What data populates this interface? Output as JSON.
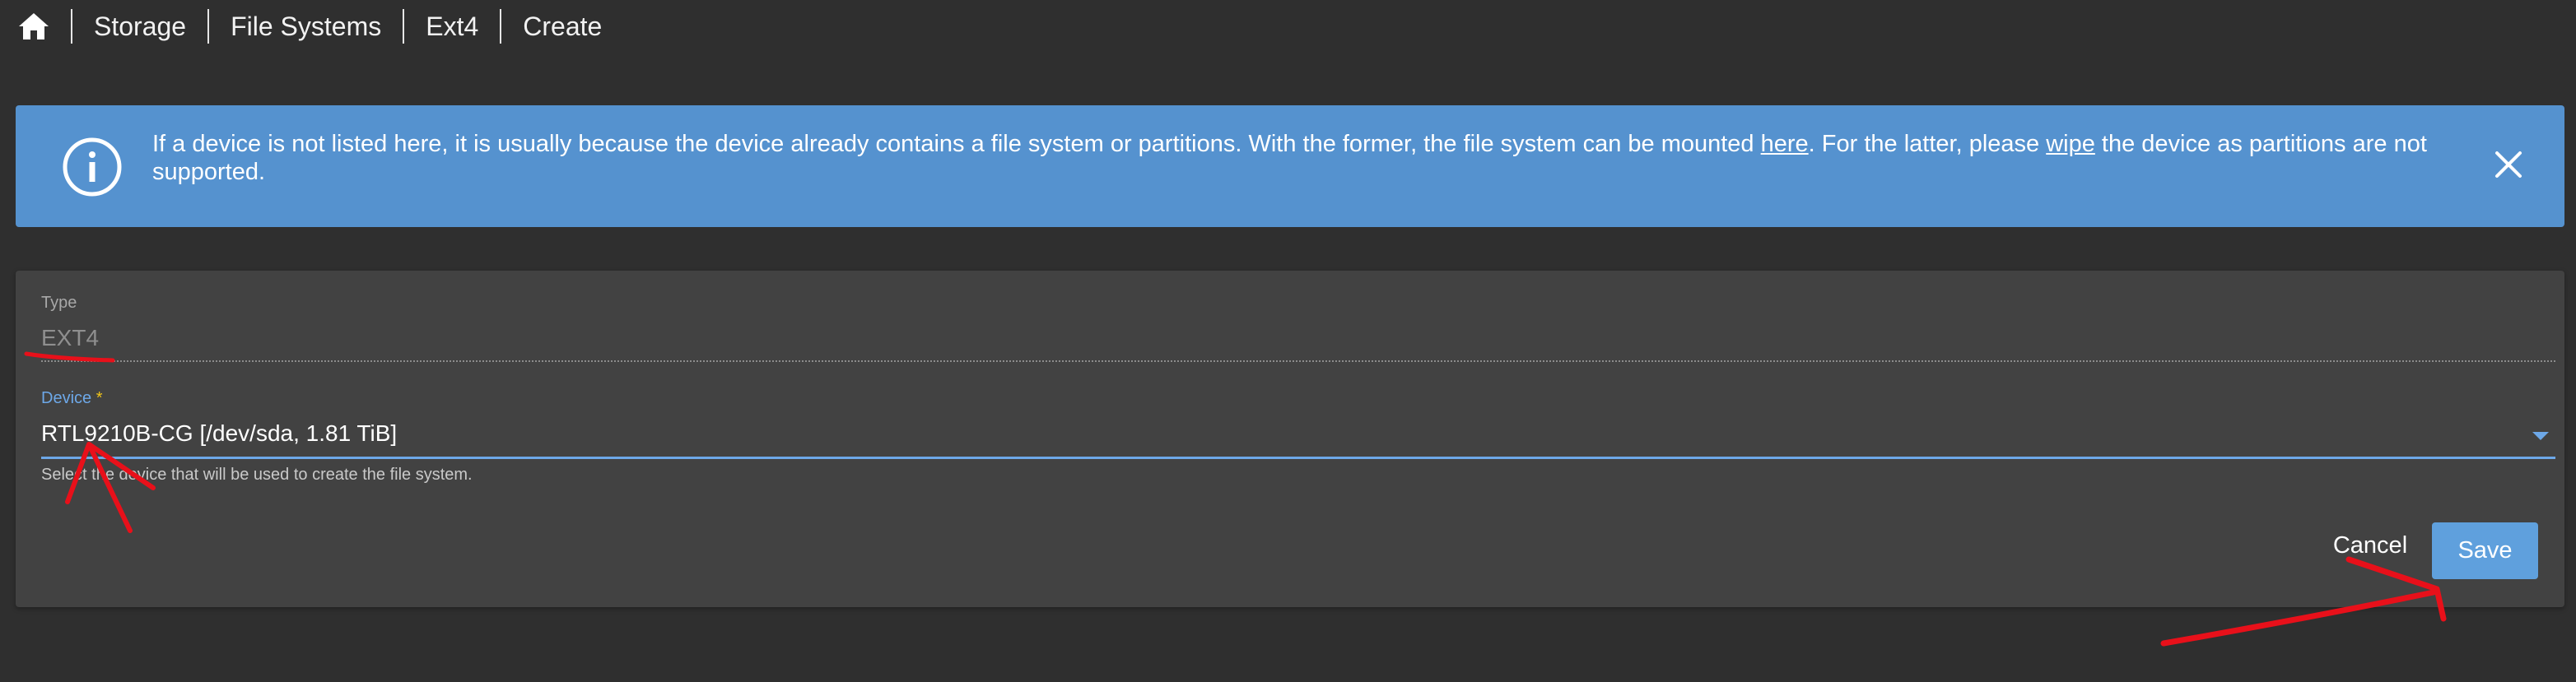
{
  "breadcrumb": {
    "home_icon": "home-icon",
    "items": [
      "Storage",
      "File Systems",
      "Ext4",
      "Create"
    ]
  },
  "banner": {
    "icon": "info-icon",
    "text_before_here": "If a device is not listed here, it is usually because the device already contains a file system or partitions. With the former, the file system can be mounted ",
    "here_link": "here",
    "text_before_wipe": ". For the latter, please ",
    "wipe_link": "wipe",
    "text_after_wipe": " the device as partitions are not supported.",
    "close_icon": "close-icon",
    "color": "#5592cf"
  },
  "form": {
    "type_label": "Type",
    "type_value": "EXT4",
    "device_label": "Device",
    "device_required_mark": "*",
    "device_value": "RTL9210B-CG [/dev/sda, 1.81 TiB]",
    "device_hint": "Select the device that will be used to create the file system.",
    "accent_color": "#6da8e8"
  },
  "actions": {
    "cancel_label": "Cancel",
    "save_label": "Save"
  },
  "annotation_color": "#e8101a"
}
